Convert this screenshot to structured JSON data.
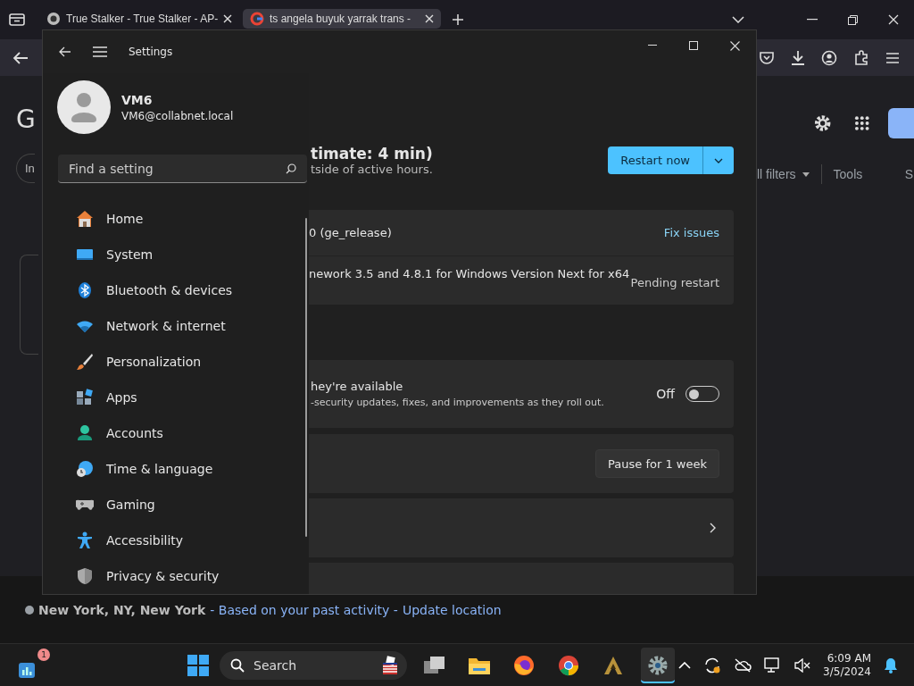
{
  "browser": {
    "tabs": [
      {
        "title": "True Stalker - True Stalker - AP-",
        "kind": "stalker",
        "selected": false
      },
      {
        "title": "ts angela buyuk yarrak trans -",
        "kind": "google",
        "selected": true
      }
    ],
    "content": {
      "logo_letter": "G",
      "chip": "In",
      "filters": "ll filters",
      "tools": "Tools",
      "cut_tab": "S",
      "location": {
        "place": "New York, NY, New York",
        "source": "- Based on your past activity -",
        "link": "Update location"
      }
    }
  },
  "settings": {
    "title": "Settings",
    "profile": {
      "name": "VM6",
      "email": "VM6@collabnet.local"
    },
    "search": {
      "placeholder": "Find a setting"
    },
    "nav": [
      {
        "label": "Home",
        "kind": "home",
        "selected": false
      },
      {
        "label": "System",
        "kind": "system",
        "selected": false
      },
      {
        "label": "Bluetooth & devices",
        "kind": "bluetooth",
        "selected": false
      },
      {
        "label": "Network & internet",
        "kind": "network",
        "selected": false
      },
      {
        "label": "Personalization",
        "kind": "brush",
        "selected": false
      },
      {
        "label": "Apps",
        "kind": "apps",
        "selected": false
      },
      {
        "label": "Accounts",
        "kind": "person",
        "selected": false
      },
      {
        "label": "Time & language",
        "kind": "globe",
        "selected": false
      },
      {
        "label": "Gaming",
        "kind": "gamepad",
        "selected": false
      },
      {
        "label": "Accessibility",
        "kind": "accessibility",
        "selected": false
      },
      {
        "label": "Privacy & security",
        "kind": "shield",
        "selected": false
      }
    ],
    "update": {
      "heading": "timate: 4 min)",
      "subtext": "tside of active hours.",
      "restart_button": "Restart now"
    },
    "updates": [
      {
        "name": "0 (ge_release)",
        "status": "Fix issues",
        "kind": "link"
      },
      {
        "name": "nework 3.5 and 4.8.1 for Windows Version Next for x64",
        "status": "Pending restart",
        "kind": "text"
      }
    ],
    "latest": {
      "title": "hey're available",
      "description": "-security updates, fixes, and improvements as they roll out.",
      "toggle_label": "Off",
      "on": false
    },
    "pause": {
      "button": "Pause for 1 week"
    }
  },
  "taskbar": {
    "widget_badge": "1",
    "search": {
      "placeholder": "Search"
    },
    "apps": [
      {
        "kind": "taskview",
        "selected": false
      },
      {
        "kind": "folder",
        "selected": false
      },
      {
        "kind": "firefox",
        "selected": false
      },
      {
        "kind": "chrome",
        "selected": false
      },
      {
        "kind": "emblem",
        "selected": false
      },
      {
        "kind": "settings",
        "selected": true
      }
    ],
    "time": "6:09 AM",
    "date": "3/5/2024"
  }
}
